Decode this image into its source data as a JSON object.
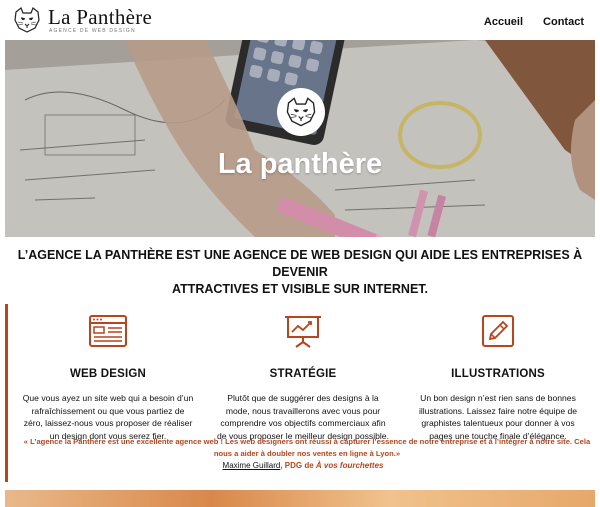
{
  "header": {
    "logo_name": "La Panthère",
    "logo_tagline": "AGENCE DE WEB DESIGN",
    "nav": [
      {
        "label": "Accueil"
      },
      {
        "label": "Contact"
      }
    ]
  },
  "hero": {
    "title": "La panthère",
    "background": "photo of designer sketching with phone and markers"
  },
  "intro": {
    "line1": "L’AGENCE LA PANTHÈRE EST UNE AGENCE DE WEB DESIGN QUI AIDE LES ENTREPRISES À DEVENIR",
    "line2": "ATTRACTIVES ET VISIBLE SUR INTERNET."
  },
  "services": [
    {
      "icon": "browser-window-icon",
      "title": "WEB DESIGN",
      "text": "Que vous ayez un site web qui a besoin d’un rafraîchissement ou que vous partiez de zéro, laissez-nous vous proposer de réaliser un design dont vous serez fier."
    },
    {
      "icon": "presentation-chart-icon",
      "title": "STRATÉGIE",
      "text": "Plutôt que de suggérer des designs à la mode, nous travaillerons avec vous pour comprendre vos objectifs commerciaux afin de vous proposer le meilleur design possible."
    },
    {
      "icon": "pencil-square-icon",
      "title": "ILLUSTRATIONS",
      "text": "Un bon design n’est rien sans de bonnes illustrations. Laissez faire notre équipe de graphistes talentueux pour donner à vos pages une touche finale d’élégance."
    }
  ],
  "testimonial": {
    "quote": "« L’agence la Panthère est une excellente agence web ! Les web designers ont réussi à capturer l’essence de notre entreprise et à l’intégrer à notre site. Cela nous a aider à doubler nos ventes en ligne à Lyon.»",
    "author": "Maxime Guillard",
    "role": ", PDG de ",
    "company": "À vos fourchettes"
  },
  "colors": {
    "accent": "#b8451b",
    "text": "#111111"
  }
}
